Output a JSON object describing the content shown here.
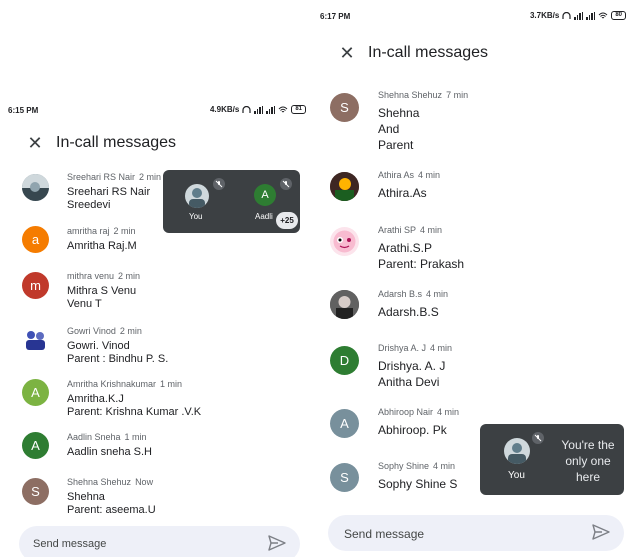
{
  "left": {
    "status": {
      "time": "6:15 PM",
      "speed": "4.9KB/s",
      "battery": "81"
    },
    "header": {
      "title": "In-call messages"
    },
    "messages": [
      {
        "name": "Sreehari RS Nair",
        "time": "2 min",
        "lines": [
          "Sreehari RS Nair",
          "Sreedevi"
        ],
        "avatar": {
          "type": "photo",
          "letter": ""
        }
      },
      {
        "name": "amritha raj",
        "time": "2 min",
        "lines": [
          "Amritha Raj.M"
        ],
        "avatar": {
          "type": "letter",
          "letter": "a",
          "color": "#f57c00"
        }
      },
      {
        "name": "mithra venu",
        "time": "2 min",
        "lines": [
          "Mithra S Venu",
          "Venu T"
        ],
        "avatar": {
          "type": "letter",
          "letter": "m",
          "color": "#c0392b"
        }
      },
      {
        "name": "Gowri Vinod",
        "time": "2 min",
        "lines": [
          "Gowri. Vinod",
          "Parent :  Bindhu P. S."
        ],
        "avatar": {
          "type": "photo",
          "letter": ""
        }
      },
      {
        "name": "Amritha Krishnakumar",
        "time": "1 min",
        "lines": [
          "Amritha.K.J",
          "Parent: Krishna Kumar .V.K"
        ],
        "avatar": {
          "type": "letter",
          "letter": "A",
          "color": "#7cb342"
        }
      },
      {
        "name": "Aadlin Sneha",
        "time": "1 min",
        "lines": [
          "Aadlin sneha S.H"
        ],
        "avatar": {
          "type": "letter",
          "letter": "A",
          "color": "#2e7d32"
        }
      },
      {
        "name": "Shehna Shehuz",
        "time": "Now",
        "lines": [
          "Shehna",
          "Parent: aseema.U"
        ],
        "avatar": {
          "type": "letter",
          "letter": "S",
          "color": "#8d6e63"
        }
      }
    ],
    "tile": {
      "you": "You",
      "other": "Aadli",
      "other_letter": "A",
      "count": "+25"
    },
    "send": {
      "placeholder": "Send message"
    }
  },
  "right": {
    "status": {
      "time": "6:17 PM",
      "speed": "3.7KB/s",
      "battery": "80"
    },
    "header": {
      "title": "In-call messages"
    },
    "messages": [
      {
        "name": "Shehna Shehuz",
        "time": "7 min",
        "lines": [
          "Shehna",
          "And",
          "Parent"
        ],
        "avatar": {
          "type": "letter",
          "letter": "S",
          "color": "#8d6e63"
        }
      },
      {
        "name": "Athira As",
        "time": "4 min",
        "lines": [
          "Athira.As"
        ],
        "avatar": {
          "type": "photo",
          "letter": ""
        }
      },
      {
        "name": "Arathi SP",
        "time": "4 min",
        "lines": [
          "Arathi.S.P",
          "Parent: Prakash"
        ],
        "avatar": {
          "type": "photo",
          "letter": ""
        }
      },
      {
        "name": "Adarsh B.s",
        "time": "4 min",
        "lines": [
          "Adarsh.B.S"
        ],
        "avatar": {
          "type": "photo",
          "letter": ""
        }
      },
      {
        "name": "Drishya A. J",
        "time": "4 min",
        "lines": [
          "Drishya. A. J",
          "Anitha Devi"
        ],
        "avatar": {
          "type": "letter",
          "letter": "D",
          "color": "#2e7d32"
        }
      },
      {
        "name": "Abhiroop Nair",
        "time": "4 min",
        "lines": [
          "Abhiroop. Pk"
        ],
        "avatar": {
          "type": "letter",
          "letter": "A",
          "color": "#78909c"
        }
      },
      {
        "name": "Sophy Shine",
        "time": "4 min",
        "lines": [
          "Sophy Shine S"
        ],
        "avatar": {
          "type": "letter",
          "letter": "S",
          "color": "#78909c"
        }
      }
    ],
    "tile": {
      "you": "You",
      "note": "You're the only one here"
    },
    "send": {
      "placeholder": "Send message"
    }
  }
}
